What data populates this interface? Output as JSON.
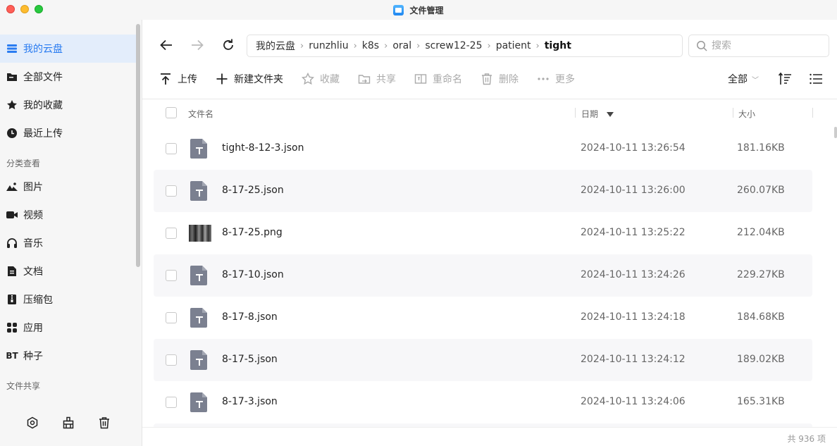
{
  "window": {
    "title": "文件管理"
  },
  "sidebar": {
    "items": [
      {
        "label": "我的云盘",
        "icon": "cloud-drive-icon"
      },
      {
        "label": "全部文件",
        "icon": "folder-icon"
      },
      {
        "label": "我的收藏",
        "icon": "star-icon"
      },
      {
        "label": "最近上传",
        "icon": "clock-icon"
      }
    ],
    "section_category": "分类查看",
    "categories": [
      {
        "label": "图片",
        "icon": "image-icon"
      },
      {
        "label": "视频",
        "icon": "video-icon"
      },
      {
        "label": "音乐",
        "icon": "headphones-icon"
      },
      {
        "label": "文档",
        "icon": "document-icon"
      },
      {
        "label": "压缩包",
        "icon": "archive-icon"
      },
      {
        "label": "应用",
        "icon": "apps-icon"
      },
      {
        "label": "种子",
        "icon": "bt-icon",
        "badge": "BT"
      }
    ],
    "section_share": "文件共享",
    "bottom_icons": [
      "settings-icon",
      "cleanup-icon",
      "trash-icon"
    ]
  },
  "breadcrumb": [
    "我的云盘",
    "runzhliu",
    "k8s",
    "oral",
    "screw12-25",
    "patient",
    "tight"
  ],
  "search": {
    "placeholder": "搜索"
  },
  "toolbar": {
    "upload": "上传",
    "new_folder": "新建文件夹",
    "favorite": "收藏",
    "share": "共享",
    "rename": "重命名",
    "delete": "删除",
    "more": "更多",
    "filter": "全部"
  },
  "table": {
    "headers": {
      "name": "文件名",
      "date": "日期",
      "size": "大小"
    },
    "rows": [
      {
        "name": "tight-8-12-3.json",
        "date": "2024-10-11 13:26:54",
        "size": "181.16KB",
        "type": "text"
      },
      {
        "name": "8-17-25.json",
        "date": "2024-10-11 13:26:00",
        "size": "260.07KB",
        "type": "text"
      },
      {
        "name": "8-17-25.png",
        "date": "2024-10-11 13:25:22",
        "size": "212.04KB",
        "type": "image"
      },
      {
        "name": "8-17-10.json",
        "date": "2024-10-11 13:24:26",
        "size": "229.27KB",
        "type": "text"
      },
      {
        "name": "8-17-8.json",
        "date": "2024-10-11 13:24:18",
        "size": "184.68KB",
        "type": "text"
      },
      {
        "name": "8-17-5.json",
        "date": "2024-10-11 13:24:12",
        "size": "189.02KB",
        "type": "text"
      },
      {
        "name": "8-17-3.json",
        "date": "2024-10-11 13:24:06",
        "size": "165.31KB",
        "type": "text"
      }
    ]
  },
  "footer": {
    "count": "共 936 项"
  },
  "colors": {
    "accent": "#2a7cf1",
    "active_bg": "#e3edfb",
    "file_icon": "#7b8090"
  }
}
